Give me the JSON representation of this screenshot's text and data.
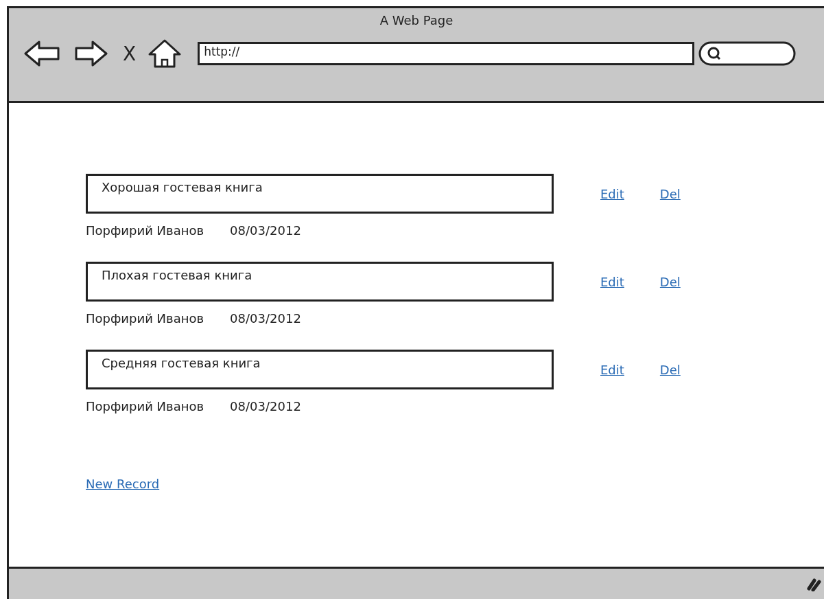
{
  "window": {
    "title": "A Web Page"
  },
  "address_bar": {
    "value": "http://"
  },
  "close_glyph": "X",
  "entries": [
    {
      "title": "Хорошая гостевая книга",
      "author": "Порфирий Иванов",
      "date": "08/03/2012",
      "actions": [
        "Edit",
        "Del"
      ]
    },
    {
      "title": "Плохая гостевая книга",
      "author": "Порфирий Иванов",
      "date": "08/03/2012",
      "actions": [
        "Edit",
        "Del"
      ]
    },
    {
      "title": "Средняя гостевая книга",
      "author": "Порфирий Иванов",
      "date": "08/03/2012",
      "actions": [
        "Edit",
        "Del"
      ]
    }
  ],
  "new_record_link": "New Record"
}
